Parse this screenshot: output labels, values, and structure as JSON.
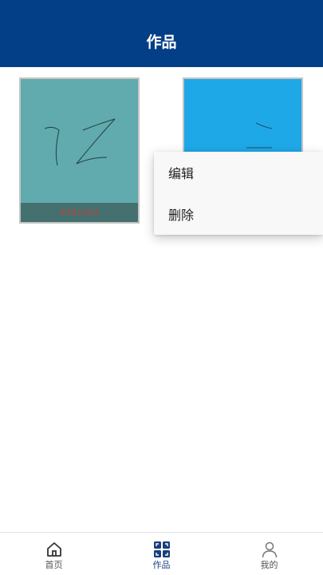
{
  "header": {
    "title": "作品"
  },
  "works": [
    {
      "caption": "9782463",
      "background": "#61aaad"
    },
    {
      "caption": "",
      "background": "#1fa8e8"
    }
  ],
  "menu": {
    "items": [
      {
        "label": "编辑"
      },
      {
        "label": "删除"
      }
    ]
  },
  "nav": {
    "items": [
      {
        "label": "首页",
        "icon": "home-icon"
      },
      {
        "label": "作品",
        "icon": "grid-icon",
        "active": true
      },
      {
        "label": "我的",
        "icon": "user-icon"
      }
    ]
  },
  "colors": {
    "header": "#033f86",
    "accent": "#1a3f7a"
  }
}
